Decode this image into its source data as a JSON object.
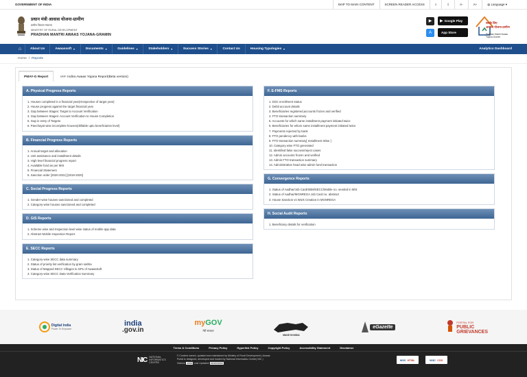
{
  "topbar": {
    "gov": "GOVERNMENT OF INDIA",
    "skip": "SKIP TO MAIN CONTENT",
    "screen_reader": "SCREEN READER ACCESS",
    "language": "Language"
  },
  "header": {
    "hindi_title": "प्रधान मंत्री आवास योजना-ग्रामीण",
    "hindi_ministry": "ग्रामीण विकास मंत्रालय",
    "ministry": "MINISTRY OF RURAL DEVELOPMENT",
    "pmay": "PRADHAN MANTRI AWAAS YOJANA-GRAMIN",
    "google_play": "Google Play",
    "app_store": "App Store",
    "logo_text1": "सबके लिए",
    "logo_text2": "आवास योजना-ग्रामीण",
    "logo_text3": "Pradhan Mantri Awaas Yojana-Gramin"
  },
  "nav": {
    "items": [
      "About Us",
      "Awaassoft",
      "Documents",
      "Guidelines",
      "Stakeholders",
      "Success Stories",
      "Contact Us",
      "Housing Typologies"
    ],
    "dashboard": "Analytics Dashboard"
  },
  "breadcrumb": {
    "home": "Home",
    "sep": "/",
    "current": "Reports"
  },
  "tabs": [
    "PMAY-G Report",
    "IAY- Indira Awaas Yojana Report(Beta version)"
  ],
  "panels": {
    "A": {
      "title": "A. Physical Progress Reports",
      "items": [
        "1. Houses completed in a financial year(Irrespective of target year)",
        "2. House progress against the target financial year",
        "3. Gap between Stages: Target to Account Verification",
        "4. Gap between Stages: Account Verification to House Completion",
        "5. Gap in entry of Targets",
        "6. Panchayat wise incomplete houses(drillable upto beneficiaries level)"
      ]
    },
    "B": {
      "title": "B. Financial Progress Reports",
      "items": [
        "1. Annual target and allocation",
        "2. Unit assistance and installment details",
        "3. High level financial progress report",
        "4. Available fund as per MIS",
        "5. Financial Statement",
        "6. Sanction order [2020-2021] [2019-2020]"
      ]
    },
    "C": {
      "title": "C. Social Progress Reports",
      "items": [
        "1. Gender-wise houses sanctioned and completed",
        "2. Category-wise houses sanctioned and completed"
      ]
    },
    "D": {
      "title": "D. GIS Reports",
      "items": [
        "1. Scheme wise and Inspection level wise status of mobile app data",
        "2. Abstract Mobile Inspection Report."
      ]
    },
    "E": {
      "title": "E. SECC Reports",
      "items": [
        "1. Category-wise SECC data summary",
        "2. Status of priority list verification by gram sabha",
        "3. Status of Mapped SECC Villages to GPs of AwaasSoft",
        "4. Category-wise SECC Data Verification Summary"
      ]
    },
    "F": {
      "title": "F. E-FMS Reports",
      "items": [
        "1. DSC enrollment status",
        "2. Debit account details",
        "3. Beneficiaries registered,accounts frozen and verified",
        "4. FTO transaction summary",
        "5. Accounts for which same installment payment initiated twice",
        "6. Beneficiaries for whom same installment payment initiated twice",
        "7. Payments rejected by bank",
        "8. FTO pendency with banks",
        "9. FTO transaction summary[ Installment Wise ]",
        "10. Category wise FTO generated",
        "11. Identified false success/reject cases",
        "12. Admin accounts frozen and verified",
        "13. Admin FTO transaction summary",
        "14. Administrative head wise admin fund transaction"
      ]
    },
    "G": {
      "title": "G. Convergence Reports",
      "items": [
        "1. Status of Aadhar/Job Card/SBM/SECC/Mobile no. seeded in MIS",
        "2. Status of Aadhar/MGNREGA Job Card no. abstract",
        "3. House Sanction vs Work Creation in MGNREGA"
      ]
    },
    "H": {
      "title": "H. Social Audit Reports",
      "items": [
        "1. Beneficiary details for verification"
      ]
    }
  },
  "partner_logos": {
    "digital_india": "Digital India",
    "digital_india_sub": "Power To Empower",
    "india_gov": "india",
    "india_gov2": ".gov.in",
    "mygov": "my",
    "mygov2": "GOV",
    "mygov_sub": "मेरी सरकार",
    "make_in_india": "MAKE IN INDIA",
    "egazette": "eGazette",
    "grievance1": "PORTAL FOR",
    "grievance2": "PUBLIC",
    "grievance3": "GRIEVANCES"
  },
  "footer": {
    "links": [
      "Terms & Conditions",
      "Privacy Policy",
      "Hyperlink Policy",
      "Copyright Policy",
      "Accessibility Statement",
      "Disclaimer"
    ],
    "nic1": "NATIONAL",
    "nic2": "INFORMATICS",
    "nic3": "CENTRE",
    "info1": "© Content owned, updated and maintained by Ministry of Rural Development | Awaas",
    "info2": "Portal is designed, developed and hosted by National Informatics Centre( NIC )",
    "visitors_label": "Visitors:",
    "visitors": "####",
    "updated_label": "Last Updated:",
    "updated": "##/##/####",
    "w3_html": "HTML",
    "w3_css": "CSS"
  },
  "colors": {
    "nav": "#1e4e8c",
    "panel_header": "#4a6f9c"
  }
}
